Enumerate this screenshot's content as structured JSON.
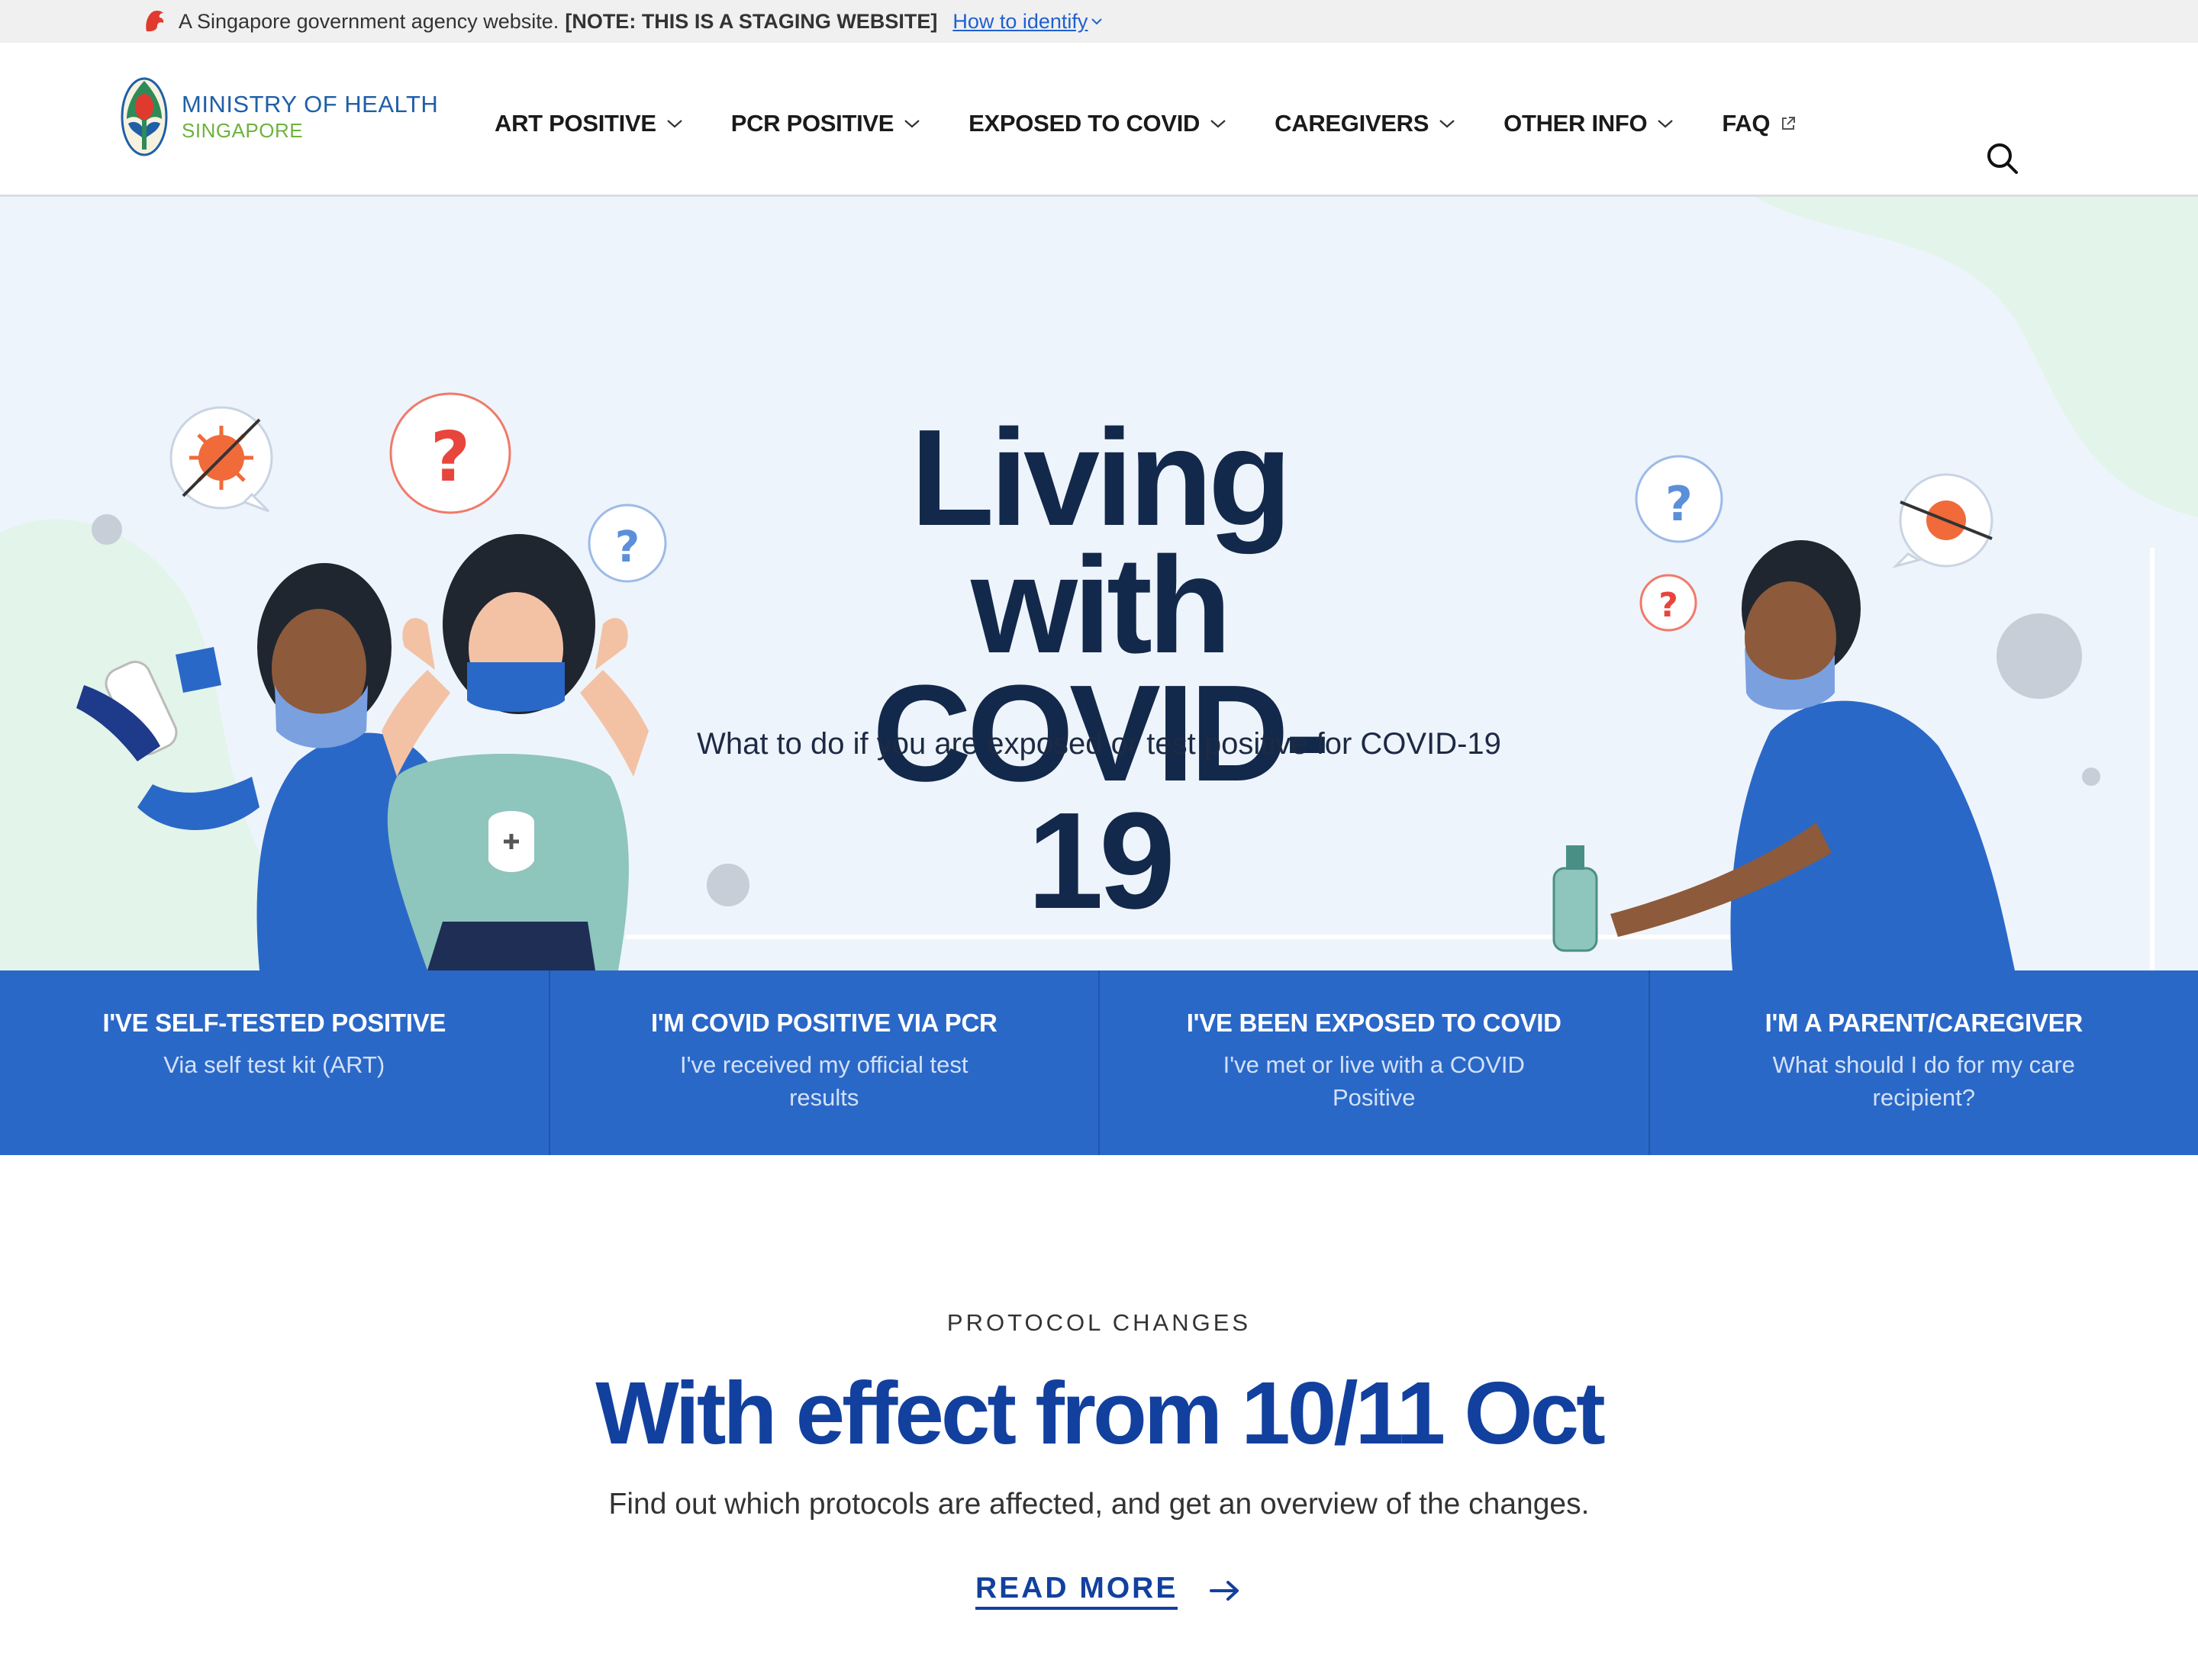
{
  "masthead": {
    "text": "A Singapore government agency website.",
    "note": "[NOTE: THIS IS A STAGING WEBSITE]",
    "identify_link": "How to identify"
  },
  "logo": {
    "line1": "MINISTRY OF HEALTH",
    "line2": "SINGAPORE"
  },
  "nav": {
    "items": [
      {
        "label": "ART POSITIVE",
        "icon": "chevron-down-icon"
      },
      {
        "label": "PCR POSITIVE",
        "icon": "chevron-down-icon"
      },
      {
        "label": "EXPOSED TO COVID",
        "icon": "chevron-down-icon"
      },
      {
        "label": "CAREGIVERS",
        "icon": "chevron-down-icon"
      },
      {
        "label": "OTHER INFO",
        "icon": "chevron-down-icon"
      },
      {
        "label": "FAQ",
        "icon": "external-link-icon"
      }
    ],
    "search_icon": "search-icon"
  },
  "hero": {
    "title_line1": "Living with",
    "title_line2": "COVID-19",
    "subtitle": "What to do if you are exposed or test positive for COVID-19"
  },
  "cards": [
    {
      "title": "I'VE SELF-TESTED POSITIVE",
      "subtitle": "Via self test kit (ART)"
    },
    {
      "title": "I'M COVID POSITIVE VIA PCR",
      "subtitle": "I've received my official test results"
    },
    {
      "title": "I'VE BEEN EXPOSED TO COVID",
      "subtitle": "I've met or live with a COVID Positive"
    },
    {
      "title": "I'M A PARENT/CAREGIVER",
      "subtitle": "What should I do for my care recipient?"
    }
  ],
  "protocol": {
    "eyebrow": "PROTOCOL CHANGES",
    "title": "With effect from 10/11 Oct",
    "description": "Find out which protocols are affected, and get an overview of the changes.",
    "read_more": "READ MORE"
  },
  "colors": {
    "primary_blue": "#2a68c8",
    "navy": "#13294b",
    "heading_blue": "#12409e",
    "hero_bg": "#eef4fb",
    "logo_blue": "#1f5fa8",
    "logo_green": "#6db33f"
  }
}
